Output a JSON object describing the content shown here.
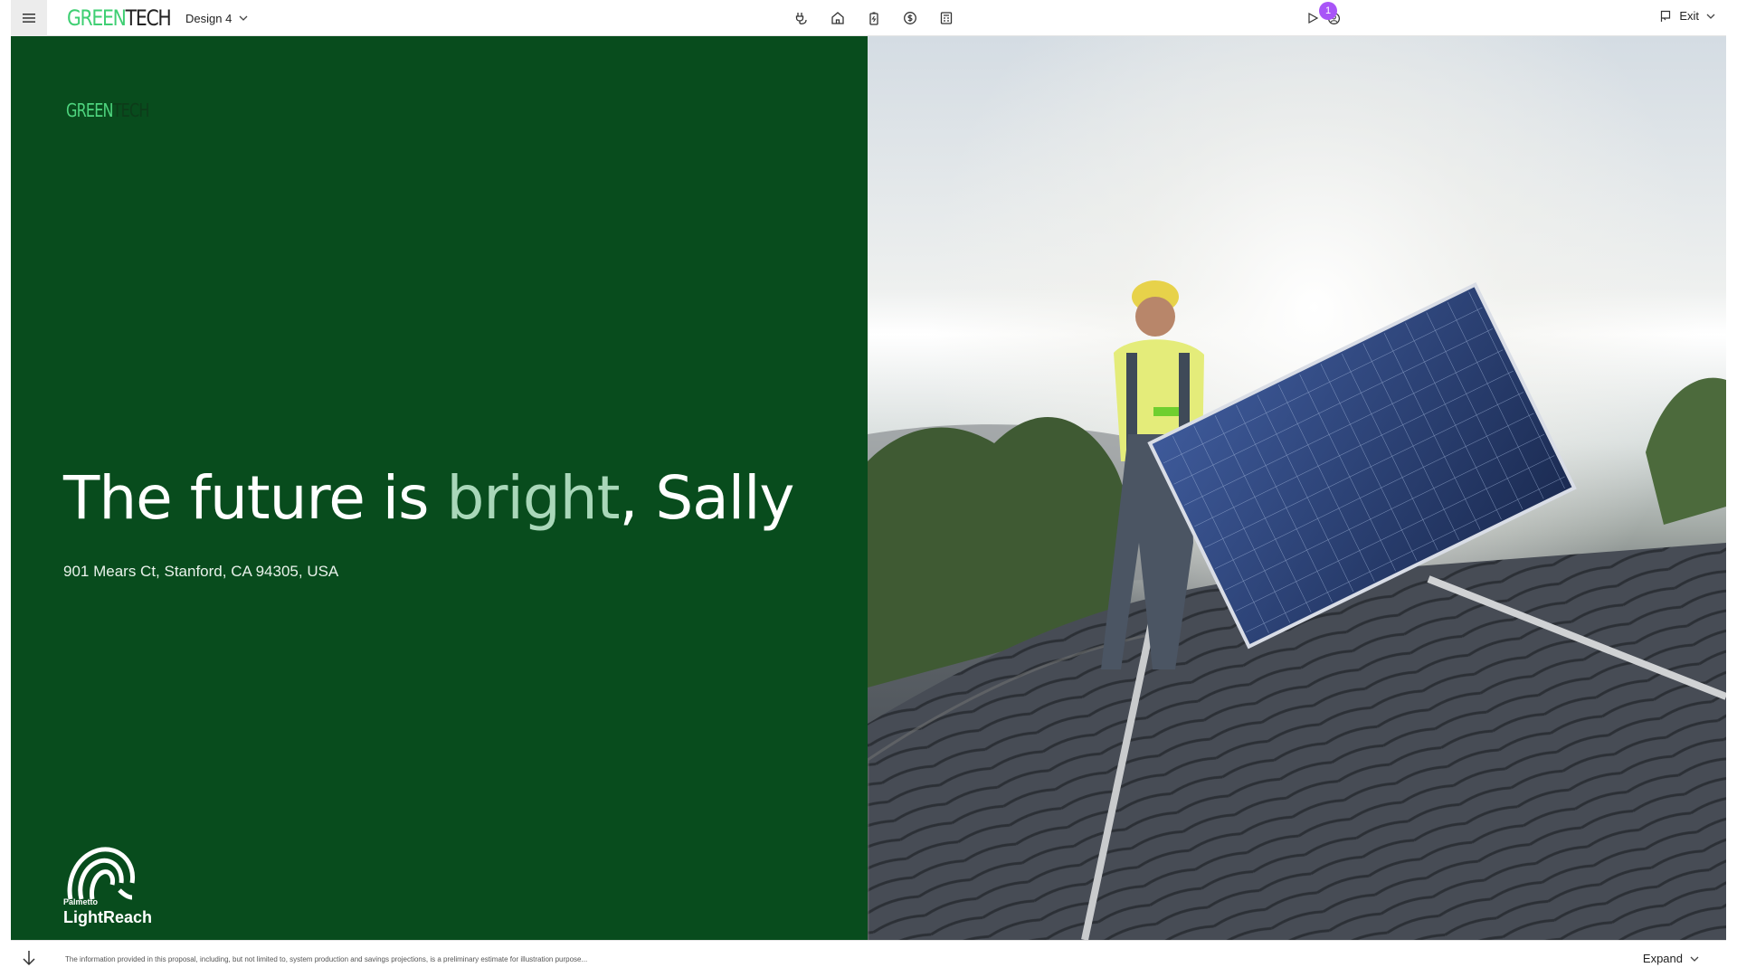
{
  "topbar": {
    "brand": {
      "green": "GREEN",
      "dark": "TECH"
    },
    "design_label": "Design 4",
    "notification_count": "1",
    "exit_label": "Exit"
  },
  "hero": {
    "logo": {
      "green": "GREEN",
      "dark": "TECH"
    },
    "title_prefix": "The future is ",
    "title_highlight": "bright",
    "title_suffix": ", Sally",
    "address": "901 Mears Ct, Stanford, CA 94305, USA",
    "partner": {
      "small": "Palmetto",
      "big": "LightReach"
    }
  },
  "footer": {
    "disclaimer": "The information provided in this proposal, including, but not limited to, system production and savings projections, is a preliminary estimate for illustration purpose...",
    "expand_label": "Expand"
  },
  "colors": {
    "hero_green": "#084c1d",
    "brand_green": "#3fcf73",
    "highlight": "#a9d7b9",
    "badge": "#a855f7"
  }
}
